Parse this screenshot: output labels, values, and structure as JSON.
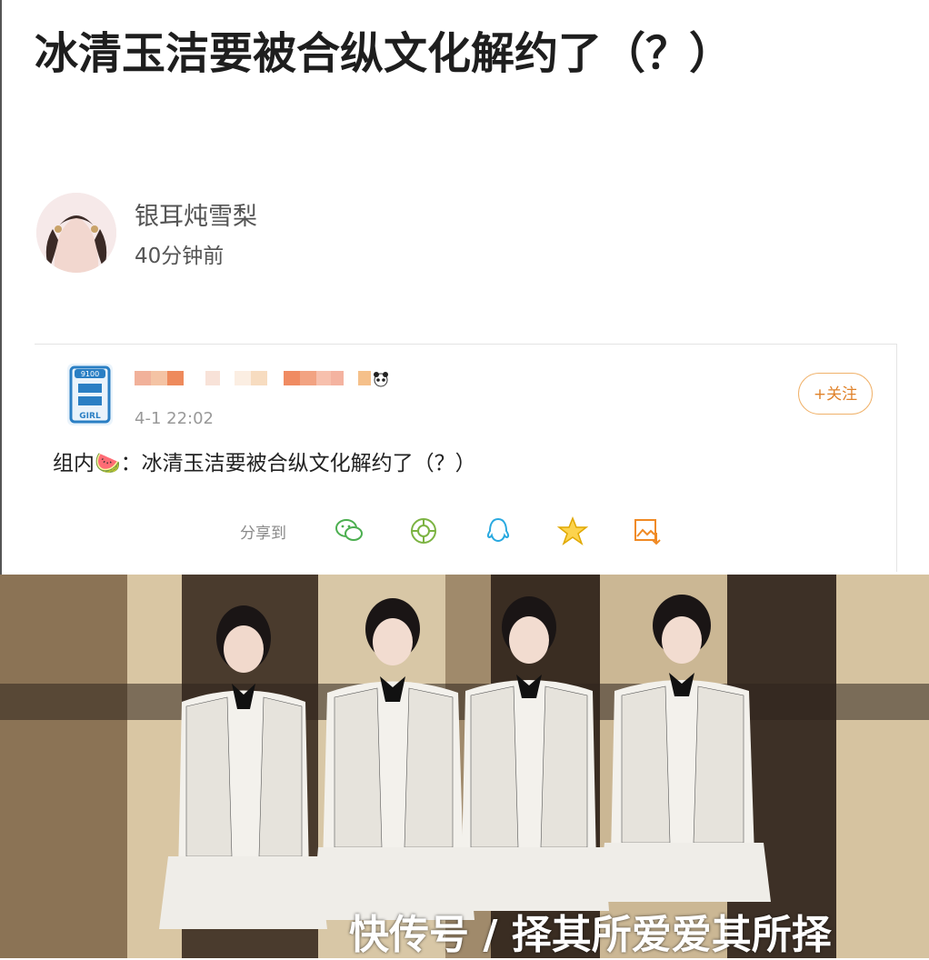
{
  "article": {
    "title": "冰清玉洁要被合纵文化解约了（？）",
    "author": "银耳炖雪梨",
    "time": "40分钟前"
  },
  "weibo_card": {
    "timestamp": "4-1 22:02",
    "follow_label": "+关注",
    "post_text": "组内🍉：冰清玉洁要被合纵文化解约了（？）",
    "share_label": "分享到",
    "share_icons": [
      "wechat-icon",
      "moments-icon",
      "qq-icon",
      "qzone-icon",
      "save-image-icon"
    ]
  },
  "watermark": "快传号 / 择其所爱爱其所择"
}
